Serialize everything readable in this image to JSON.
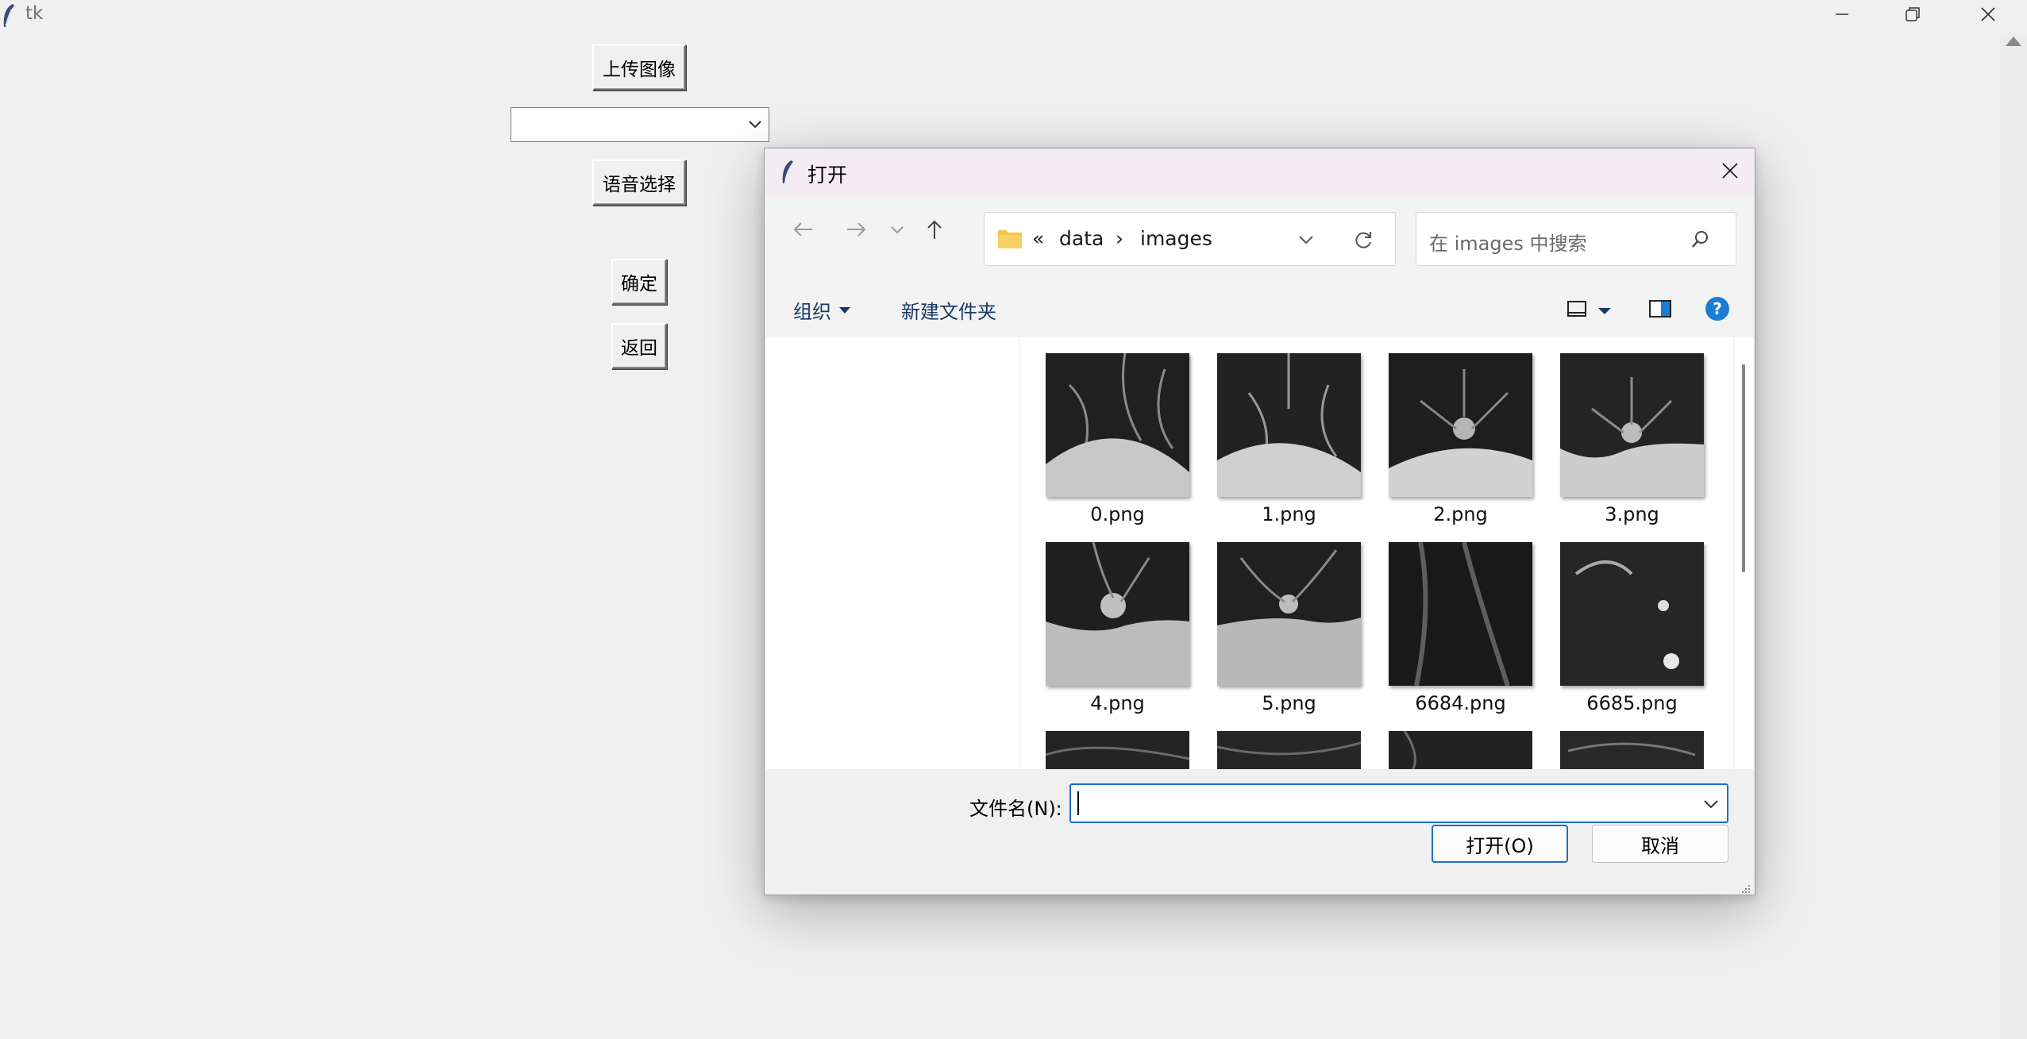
{
  "window": {
    "title": "tk"
  },
  "main_controls": {
    "upload_label": "上传图像",
    "combo_value": "",
    "voice_label": "语音选择",
    "confirm_label": "确定",
    "back_label": "返回"
  },
  "dialog": {
    "title": "打开",
    "breadcrumb": {
      "overflow": "«",
      "parent": "data",
      "separator": "›",
      "current": "images"
    },
    "search_placeholder": "在 images 中搜索",
    "organize_label": "组织",
    "new_folder_label": "新建文件夹",
    "files": [
      {
        "name": "0.png"
      },
      {
        "name": "1.png"
      },
      {
        "name": "2.png"
      },
      {
        "name": "3.png"
      },
      {
        "name": "4.png"
      },
      {
        "name": "5.png"
      },
      {
        "name": "6684.png"
      },
      {
        "name": "6685.png"
      },
      {
        "name": ""
      },
      {
        "name": ""
      },
      {
        "name": ""
      },
      {
        "name": ""
      }
    ],
    "filename_label": "文件名(N):",
    "filename_value": "",
    "open_label": "打开(O)",
    "cancel_label": "取消"
  },
  "colors": {
    "dialog_title_bg": "#f4ecf3",
    "accent_blue": "#1f6fc7",
    "folder_yellow": "#f6c343",
    "help_blue": "#1a7fd4"
  },
  "icons": [
    "feather-icon",
    "minimize-icon",
    "restore-icon",
    "close-icon",
    "back-arrow-icon",
    "forward-arrow-icon",
    "recent-chevron-icon",
    "up-arrow-icon",
    "folder-icon",
    "refresh-icon",
    "search-icon",
    "view-icon",
    "preview-pane-icon",
    "help-icon",
    "resize-grip-icon"
  ]
}
